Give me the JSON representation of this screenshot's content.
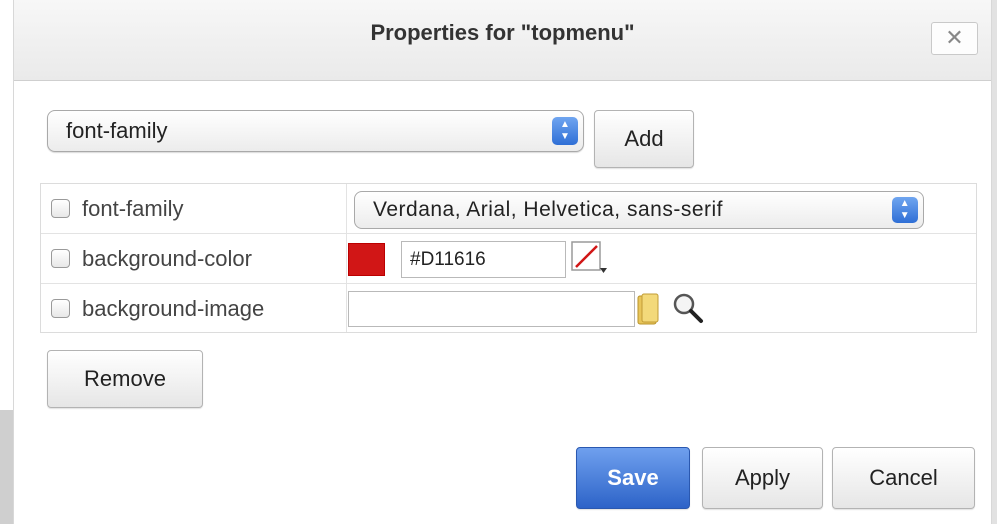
{
  "dialog": {
    "title": "Properties for \"topmenu\"",
    "close_label": "✕"
  },
  "property_picker": {
    "selected": "font-family",
    "add_label": "Add"
  },
  "properties": [
    {
      "name": "font-family",
      "checked": false,
      "value": "Verdana, Arial, Helvetica, sans-serif"
    },
    {
      "name": "background-color",
      "checked": false,
      "value": "#D11616",
      "swatch_color": "#D11616"
    },
    {
      "name": "background-image",
      "checked": false,
      "value": ""
    }
  ],
  "buttons": {
    "remove": "Remove",
    "save": "Save",
    "apply": "Apply",
    "cancel": "Cancel"
  },
  "colors": {
    "accent": "#2d63c8",
    "swatch": "#D11616"
  },
  "icons": [
    "select-arrows-icon",
    "no-color-icon",
    "folder-icon",
    "magnifier-icon"
  ]
}
